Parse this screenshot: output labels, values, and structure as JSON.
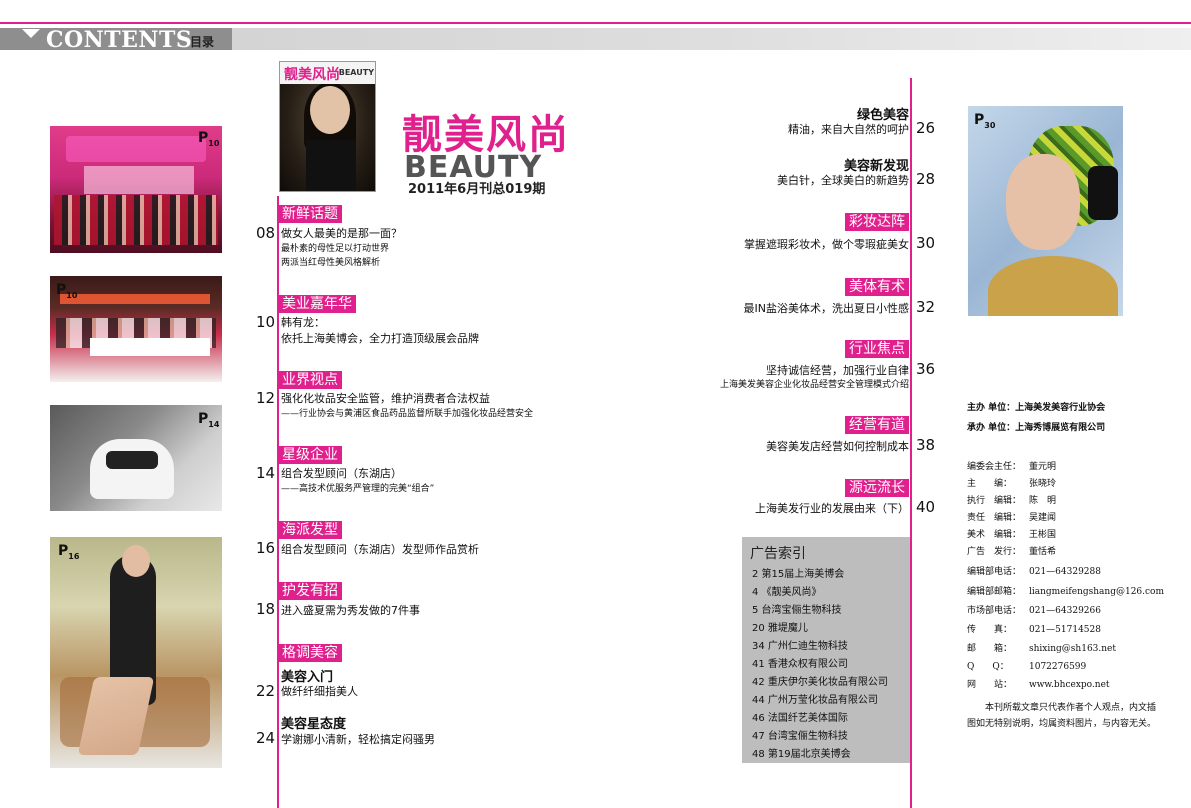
{
  "header": {
    "title": "CONTENTS",
    "subtitle": "目录"
  },
  "photos": {
    "p1_badge": "P",
    "p1_num": "10",
    "p2_badge": "P",
    "p2_num": "10",
    "p3_badge": "P",
    "p3_num": "14",
    "p4_badge": "P",
    "p4_num": "16",
    "right_badge": "P",
    "right_num": "30"
  },
  "cover": {
    "masthead": "靓美风尚",
    "masthead_en": "BEAUTY"
  },
  "brand": {
    "name": "靓美风尚",
    "name_en": "BEAUTY",
    "issue": "2011年6月刊总019期"
  },
  "left_sections": [
    {
      "tag": "新鲜话题",
      "page": "08",
      "lines": [
        "做女人最美的是那一面？",
        "最朴素的母性足以打动世界",
        "两派当红母性美风格解析"
      ]
    },
    {
      "tag": "美业嘉年华",
      "page": "10",
      "lines": [
        "韩有龙：",
        "依托上海美博会，全力打造顶级展会品牌"
      ]
    },
    {
      "tag": "业界视点",
      "page": "12",
      "lines": [
        "强化化妆品安全监管，维护消费者合法权益",
        "——行业协会与黄浦区食品药品监督所联手加强化妆品经营安全"
      ]
    },
    {
      "tag": "星级企业",
      "page": "14",
      "lines": [
        "组合发型顾问（东湖店）",
        "——高技术优服务严管理的完美“组合”"
      ]
    },
    {
      "tag": "海派发型",
      "page": "16",
      "lines": [
        "组合发型顾问（东湖店）发型师作品赏析"
      ]
    },
    {
      "tag": "护发有招",
      "page": "18",
      "lines": [
        "进入盛夏需为秀发做的7件事"
      ]
    },
    {
      "tag": "格调美容"
    },
    {
      "title": "美容入门",
      "page": "22",
      "lines": [
        "做纤纤细指美人"
      ]
    },
    {
      "title": "美容星态度",
      "page": "24",
      "lines": [
        "学谢娜小清新，轻松搞定闷骚男"
      ]
    }
  ],
  "right_sections": [
    {
      "title": "绿色美容",
      "page": "26",
      "lines": [
        "精油，来自大自然的呵护"
      ]
    },
    {
      "title": "美容新发现",
      "page": "28",
      "lines": [
        "美白针，全球美白的新趋势"
      ]
    },
    {
      "tag": "彩妆达阵",
      "page": "30",
      "lines": [
        "掌握遮瑕彩妆术，做个零瑕疵美女"
      ]
    },
    {
      "tag": "美体有术",
      "page": "32",
      "lines": [
        "最IN盐浴美体术，洗出夏日小性感"
      ]
    },
    {
      "tag": "行业焦点",
      "page": "36",
      "lines": [
        "坚持诚信经营，加强行业自律",
        "上海美发美容企业化妆品经营安全管理模式介绍"
      ]
    },
    {
      "tag": "经营有道",
      "page": "38",
      "lines": [
        "美容美发店经营如何控制成本"
      ]
    },
    {
      "tag": "源远流长",
      "page": "40",
      "lines": [
        "上海美发行业的发展由来（下）"
      ]
    }
  ],
  "ads": {
    "title": "广告索引",
    "items": [
      "2 第15届上海美博会",
      "4 《靓美风尚》",
      "5 台湾宝俪生物科技",
      "20 雅堤魔儿",
      "34 广州仁迪生物科技",
      "41 香港众权有限公司",
      "42 重庆伊尔美化妆品有限公司",
      "44 广州万莹化妆品有限公司",
      "46 法国纤艺美体国际",
      "47 台湾宝俪生物科技",
      "48 第19届北京美博会"
    ]
  },
  "publisher": {
    "host_label": "主办 单位：",
    "host": "上海美发美容行业协会",
    "organizer_label": "承办 单位：",
    "organizer": "上海秀博展览有限公司"
  },
  "staff": [
    {
      "label": "编委会主任：",
      "value": "董元明"
    },
    {
      "label": "主　　编：",
      "value": "张晓玲"
    },
    {
      "label": "执行　编辑：",
      "value": "陈　明"
    },
    {
      "label": "责任　编辑：",
      "value": "吴建闻"
    },
    {
      "label": "美术　编辑：",
      "value": "王彬国"
    },
    {
      "label": "广告　发行：",
      "value": "董恬希"
    },
    {
      "label": "编辑部电话：",
      "value": "021—64329288"
    },
    {
      "label": "编辑部邮箱：",
      "value": "liangmeifengshang@126.com"
    },
    {
      "label": "市场部电话：",
      "value": "021—64329266"
    },
    {
      "label": "传　　真：",
      "value": "021—51714528"
    },
    {
      "label": "邮　　箱：",
      "value": "shixing@sh163.net"
    },
    {
      "label": "Q　　Q：",
      "value": "1072276599"
    },
    {
      "label": "网　　站：",
      "value": "www.bhcexpo.net"
    }
  ],
  "note": "本刊所载文章只代表作者个人观点，内文插图如无特别说明，均属资料图片，与内容无关。"
}
